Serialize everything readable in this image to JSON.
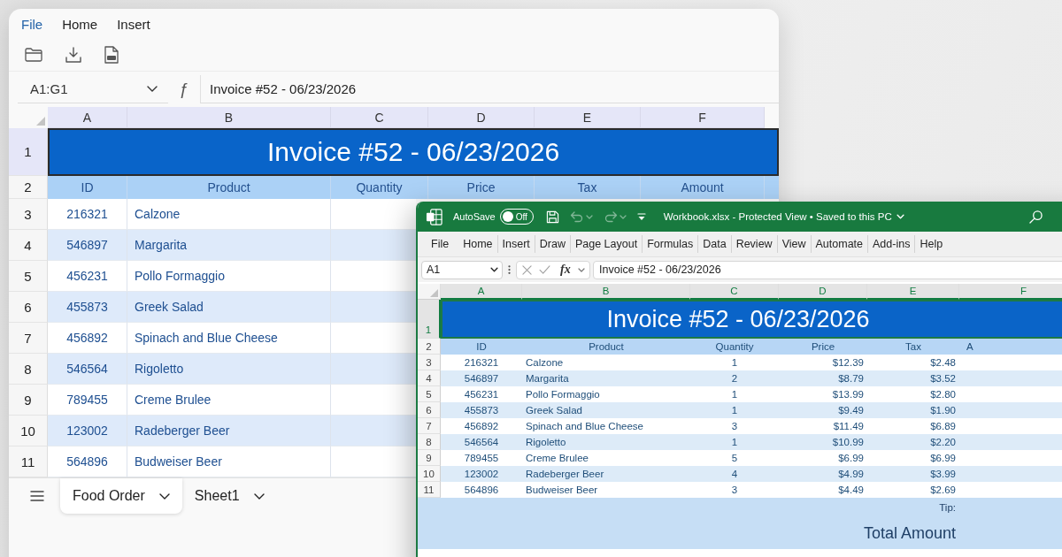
{
  "background_window": {
    "menu": [
      {
        "label": "File",
        "selected": true
      },
      {
        "label": "Home",
        "selected": false
      },
      {
        "label": "Insert",
        "selected": false
      }
    ],
    "toolbar": [
      {
        "kind": "open"
      },
      {
        "kind": "download"
      },
      {
        "kind": "pdf"
      }
    ],
    "name_box": "A1:G1",
    "formula_icon": "ƒ",
    "formula": "Invoice #52 - 06/23/2026",
    "column_headers": [
      {
        "label": "A",
        "selected": true
      },
      {
        "label": "B",
        "selected": true
      },
      {
        "label": "C",
        "selected": true
      },
      {
        "label": "D",
        "selected": true
      },
      {
        "label": "E",
        "selected": true
      },
      {
        "label": "F",
        "selected": true
      }
    ],
    "row_headers": [
      {
        "label": "1",
        "selected": true
      },
      {
        "label": "2",
        "selected": false
      },
      {
        "label": "3",
        "selected": false
      },
      {
        "label": "4",
        "selected": false
      },
      {
        "label": "5",
        "selected": false
      },
      {
        "label": "6",
        "selected": false
      },
      {
        "label": "7",
        "selected": false
      },
      {
        "label": "8",
        "selected": false
      },
      {
        "label": "9",
        "selected": false
      },
      {
        "label": "10",
        "selected": false
      },
      {
        "label": "11",
        "selected": false
      }
    ],
    "title": "Invoice #52 - 06/23/2026",
    "table_header": [
      "ID",
      "Product",
      "Quantity",
      "Price",
      "Tax",
      "Amount"
    ],
    "rows": [
      {
        "id": "216321",
        "product": "Calzone"
      },
      {
        "id": "546897",
        "product": "Margarita"
      },
      {
        "id": "456231",
        "product": "Pollo Formaggio"
      },
      {
        "id": "455873",
        "product": "Greek Salad"
      },
      {
        "id": "456892",
        "product": "Spinach and Blue Cheese"
      },
      {
        "id": "546564",
        "product": "Rigoletto"
      },
      {
        "id": "789455",
        "product": "Creme Brulee"
      },
      {
        "id": "123002",
        "product": "Radeberger Beer"
      },
      {
        "id": "564896",
        "product": "Budweiser Beer"
      }
    ],
    "sheet_tabs": [
      {
        "label": "Food Order",
        "selected": true
      },
      {
        "label": "Sheet1",
        "selected": false
      }
    ]
  },
  "excel_window": {
    "autosave": {
      "label": "AutoSave",
      "on": false,
      "state_label": "Off"
    },
    "quick_access": [
      {
        "kind": "save",
        "disabled": false
      },
      {
        "kind": "undo",
        "disabled": true
      },
      {
        "kind": "redo",
        "disabled": true
      },
      {
        "kind": "customize",
        "disabled": false
      }
    ],
    "title": "Workbook.xlsx - Protected View • Saved to this PC",
    "ribbon_tabs": [
      "File",
      "Home",
      "Insert",
      "Draw",
      "Page Layout",
      "Formulas",
      "Data",
      "Review",
      "View",
      "Automate",
      "Add-ins",
      "Help"
    ],
    "name_box": "A1",
    "function_label": "fx",
    "formula": "Invoice #52 - 06/23/2026",
    "column_headers": [
      {
        "label": "A",
        "selected": true
      },
      {
        "label": "B",
        "selected": true
      },
      {
        "label": "C",
        "selected": true
      },
      {
        "label": "D",
        "selected": true
      },
      {
        "label": "E",
        "selected": true
      },
      {
        "label": "F",
        "selected": true
      }
    ],
    "row_headers": [
      {
        "label": "1",
        "selected": true
      },
      {
        "label": "2",
        "selected": false
      },
      {
        "label": "3",
        "selected": false
      },
      {
        "label": "4",
        "selected": false
      },
      {
        "label": "5",
        "selected": false
      },
      {
        "label": "6",
        "selected": false
      },
      {
        "label": "7",
        "selected": false
      },
      {
        "label": "8",
        "selected": false
      },
      {
        "label": "9",
        "selected": false
      },
      {
        "label": "10",
        "selected": false
      },
      {
        "label": "11",
        "selected": false
      }
    ],
    "title_cell": "Invoice #52 - 06/23/2026",
    "table_header": [
      "ID",
      "Product",
      "Quantity",
      "Price",
      "Tax",
      "A"
    ],
    "rows": [
      {
        "id": "216321",
        "product": "Calzone",
        "quantity": "1",
        "price": "$12.39",
        "tax": "$2.48"
      },
      {
        "id": "546897",
        "product": "Margarita",
        "quantity": "2",
        "price": "$8.79",
        "tax": "$3.52"
      },
      {
        "id": "456231",
        "product": "Pollo Formaggio",
        "quantity": "1",
        "price": "$13.99",
        "tax": "$2.80"
      },
      {
        "id": "455873",
        "product": "Greek Salad",
        "quantity": "1",
        "price": "$9.49",
        "tax": "$1.90"
      },
      {
        "id": "456892",
        "product": "Spinach and Blue Cheese",
        "quantity": "3",
        "price": "$11.49",
        "tax": "$6.89"
      },
      {
        "id": "546564",
        "product": "Rigoletto",
        "quantity": "1",
        "price": "$10.99",
        "tax": "$2.20"
      },
      {
        "id": "789455",
        "product": "Creme Brulee",
        "quantity": "5",
        "price": "$6.99",
        "tax": "$6.99"
      },
      {
        "id": "123002",
        "product": "Radeberger Beer",
        "quantity": "4",
        "price": "$4.99",
        "tax": "$3.99"
      },
      {
        "id": "564896",
        "product": "Budweiser Beer",
        "quantity": "3",
        "price": "$4.49",
        "tax": "$2.69"
      }
    ],
    "tip_label": "Tip:",
    "total_label": "Total Amount"
  }
}
